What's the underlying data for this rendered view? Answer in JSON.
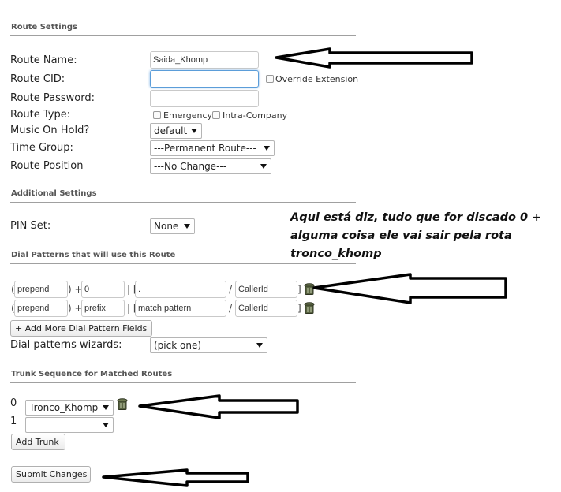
{
  "route_settings": {
    "title": "Route Settings",
    "route_name_label": "Route Name:",
    "route_name_value": "Saida_Khomp",
    "route_cid_label": "Route CID:",
    "route_cid_value": "",
    "override_extension_label": "Override Extension",
    "route_password_label": "Route Password:",
    "route_password_value": "",
    "route_type_label": "Route Type:",
    "emergency_label": "Emergency",
    "intra_company_label": "Intra-Company",
    "music_on_hold_label": "Music On Hold?",
    "music_on_hold_value": "default",
    "time_group_label": "Time Group:",
    "time_group_value": "---Permanent Route---",
    "route_position_label": "Route Position",
    "route_position_value": "---No Change---"
  },
  "additional_settings": {
    "title": "Additional Settings",
    "pin_set_label": "PIN Set:",
    "pin_set_value": "None"
  },
  "dial_patterns": {
    "title": "Dial Patterns that will use this Route",
    "rows": [
      {
        "prepend": "prepend",
        "prefix": "0",
        "match_pattern": ".",
        "caller_id": "CallerId"
      },
      {
        "prepend": "prepend",
        "prefix": "prefix",
        "match_pattern": "match pattern",
        "caller_id": "CallerId"
      }
    ],
    "open_paren": "(",
    "close_paren_plus": ") +",
    "pipe_bracket": "| [",
    "slash": "/",
    "close_bracket": "]",
    "add_more_label": "+ Add More Dial Pattern Fields",
    "wizards_label": "Dial patterns wizards:",
    "wizards_value": "(pick one)"
  },
  "trunk_sequence": {
    "title": "Trunk Sequence for Matched Routes",
    "rows": [
      {
        "index": "0",
        "trunk": "Tronco_Khomp"
      },
      {
        "index": "1",
        "trunk": ""
      }
    ],
    "add_trunk_label": "Add Trunk"
  },
  "submit_label": "Submit Changes",
  "annotation": "Aqui está diz, tudo que for discado 0 + alguma coisa ele vai sair pela rota tronco_khomp"
}
